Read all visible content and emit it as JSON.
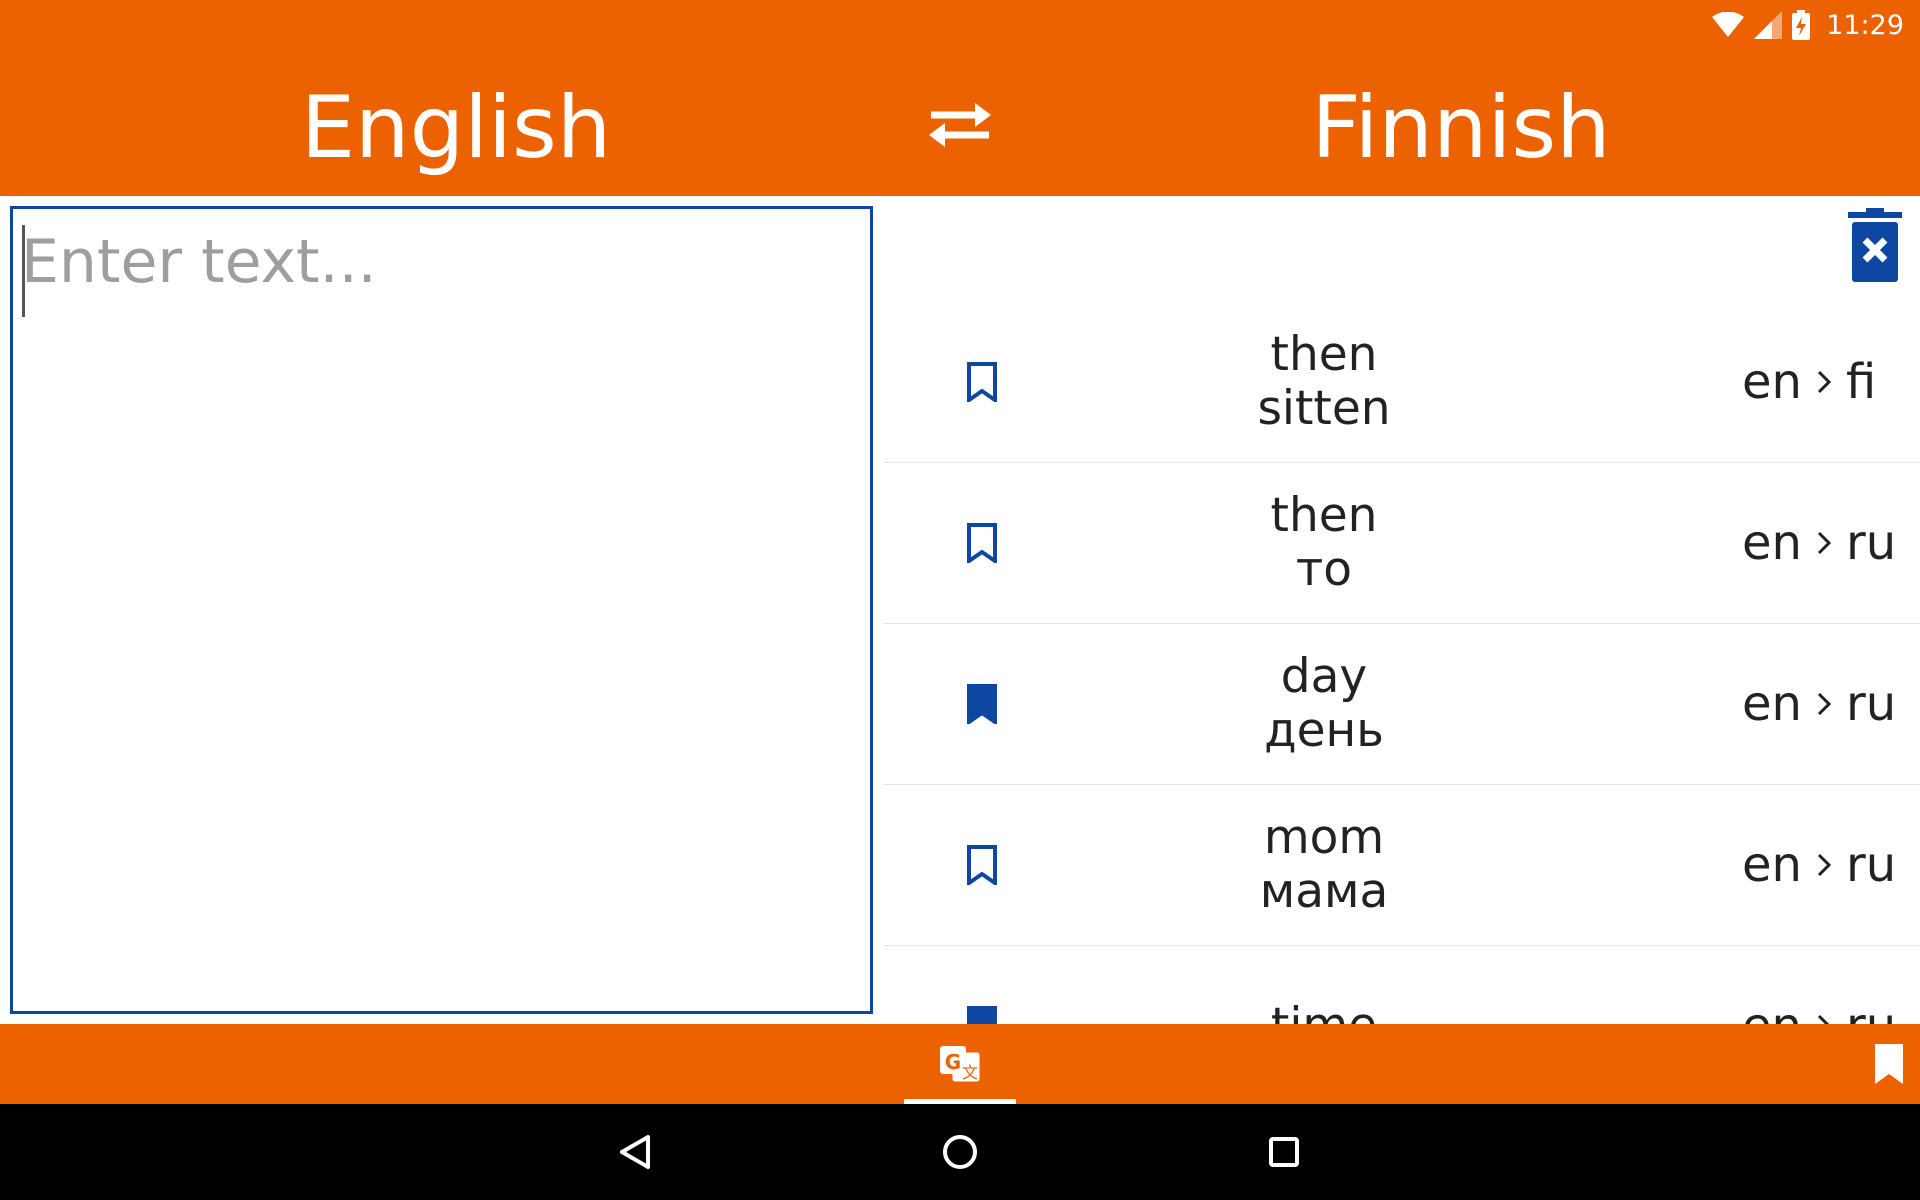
{
  "status": {
    "time": "11:29"
  },
  "header": {
    "source_language": "English",
    "target_language": "Finnish"
  },
  "input": {
    "placeholder": "Enter text...",
    "value": ""
  },
  "history": [
    {
      "word": "then",
      "translation": "sitten",
      "from": "en",
      "to": "fi",
      "bookmarked": false
    },
    {
      "word": "then",
      "translation": "то",
      "from": "en",
      "to": "ru",
      "bookmarked": false
    },
    {
      "word": "day",
      "translation": "день",
      "from": "en",
      "to": "ru",
      "bookmarked": true
    },
    {
      "word": "mom",
      "translation": "мама",
      "from": "en",
      "to": "ru",
      "bookmarked": false
    },
    {
      "word": "time",
      "translation": "",
      "from": "en",
      "to": "ru",
      "bookmarked": true
    }
  ],
  "colors": {
    "accent": "#EC6200",
    "primary_blue": "#0D47A1",
    "text": "#222222",
    "placeholder": "#9E9E9E"
  },
  "icons": {
    "swap": "swap-arrows-icon",
    "clear_history": "trash-x-icon",
    "translate_tab": "google-translate-icon",
    "bookmarks_tab": "bookmark-icon"
  }
}
